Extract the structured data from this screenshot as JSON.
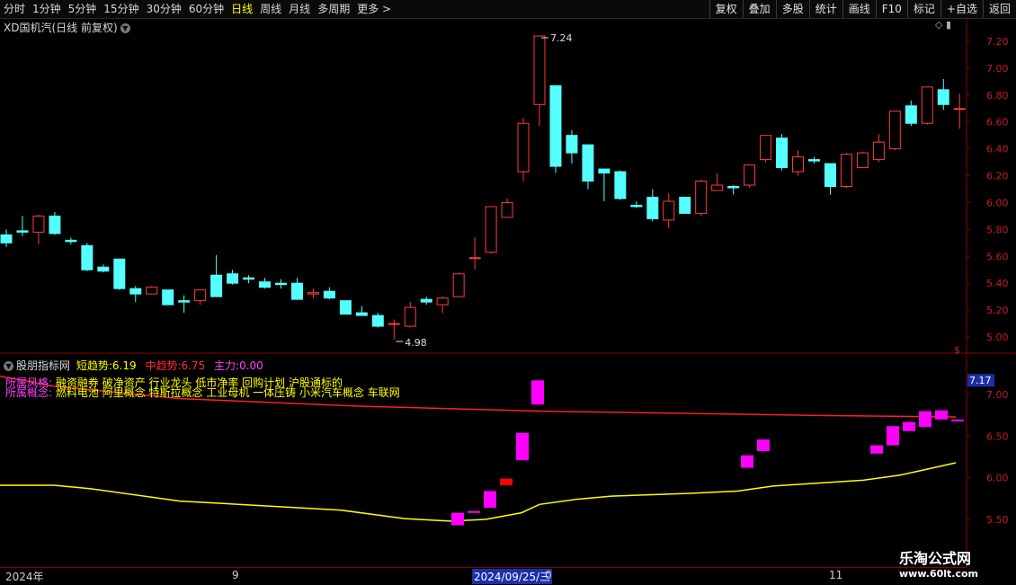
{
  "toolbar": {
    "periods": [
      "分时",
      "1分钟",
      "5分钟",
      "15分钟",
      "30分钟",
      "60分钟",
      "日线",
      "周线",
      "月线",
      "多周期",
      "更多 >"
    ],
    "active_period": "日线",
    "actions": [
      "复权",
      "叠加",
      "多股",
      "统计",
      "画线",
      "F10",
      "标记",
      "+自选",
      "返回"
    ]
  },
  "main_chart": {
    "title": "XD国机汽(日线 前复权)",
    "max_label": "7.24",
    "min_label": "4.98",
    "dollar_icon": "$",
    "y_ticks": [
      "7.20",
      "7.00",
      "6.80",
      "6.60",
      "6.40",
      "6.20",
      "6.00",
      "5.80",
      "5.60",
      "5.40",
      "5.20",
      "5.00"
    ],
    "candles": [
      [
        5.76,
        5.7,
        5.8,
        5.67
      ],
      [
        5.79,
        5.78,
        5.9,
        5.75
      ],
      [
        5.78,
        5.9,
        5.91,
        5.69
      ],
      [
        5.9,
        5.77,
        5.93,
        5.76
      ],
      [
        5.72,
        5.71,
        5.74,
        5.69
      ],
      [
        5.68,
        5.5,
        5.7,
        5.49
      ],
      [
        5.52,
        5.49,
        5.54,
        5.48
      ],
      [
        5.58,
        5.36,
        5.58,
        5.35
      ],
      [
        5.36,
        5.32,
        5.38,
        5.26
      ],
      [
        5.32,
        5.37,
        5.38,
        5.32
      ],
      [
        5.35,
        5.24,
        5.35,
        5.24
      ],
      [
        5.27,
        5.26,
        5.31,
        5.18
      ],
      [
        5.27,
        5.35,
        5.35,
        5.24
      ],
      [
        5.46,
        5.3,
        5.61,
        5.3
      ],
      [
        5.47,
        5.4,
        5.5,
        5.39
      ],
      [
        5.44,
        5.43,
        5.46,
        5.4
      ],
      [
        5.41,
        5.37,
        5.44,
        5.36
      ],
      [
        5.4,
        5.39,
        5.43,
        5.36
      ],
      [
        5.4,
        5.28,
        5.44,
        5.28
      ],
      [
        5.32,
        5.33,
        5.36,
        5.29
      ],
      [
        5.34,
        5.29,
        5.37,
        5.28
      ],
      [
        5.27,
        5.17,
        5.27,
        5.17
      ],
      [
        5.18,
        5.16,
        5.23,
        5.16
      ],
      [
        5.16,
        5.08,
        5.18,
        5.07
      ],
      [
        5.1,
        5.1,
        5.13,
        4.98
      ],
      [
        5.08,
        5.22,
        5.26,
        5.07
      ],
      [
        5.28,
        5.26,
        5.3,
        5.24
      ],
      [
        5.24,
        5.29,
        5.3,
        5.18
      ],
      [
        5.3,
        5.47,
        5.48,
        5.3
      ],
      [
        5.59,
        5.59,
        5.74,
        5.5
      ],
      [
        5.63,
        5.97,
        5.97,
        5.62
      ],
      [
        5.89,
        6.0,
        6.03,
        5.89
      ],
      [
        6.23,
        6.59,
        6.63,
        6.16
      ],
      [
        6.73,
        7.24,
        7.24,
        6.57
      ],
      [
        6.87,
        6.27,
        6.87,
        6.22
      ],
      [
        6.5,
        6.37,
        6.54,
        6.29
      ],
      [
        6.43,
        6.16,
        6.43,
        6.1
      ],
      [
        6.25,
        6.22,
        6.25,
        6.01
      ],
      [
        6.23,
        6.03,
        6.24,
        6.02
      ],
      [
        5.98,
        5.97,
        6.01,
        5.96
      ],
      [
        6.04,
        5.88,
        6.1,
        5.86
      ],
      [
        5.87,
        6.01,
        6.07,
        5.81
      ],
      [
        6.04,
        5.92,
        6.04,
        5.92
      ],
      [
        5.92,
        6.16,
        6.17,
        5.9
      ],
      [
        6.09,
        6.13,
        6.22,
        6.09
      ],
      [
        6.12,
        6.11,
        6.13,
        6.06
      ],
      [
        6.13,
        6.28,
        6.28,
        6.11
      ],
      [
        6.32,
        6.5,
        6.5,
        6.3
      ],
      [
        6.48,
        6.26,
        6.51,
        6.24
      ],
      [
        6.23,
        6.34,
        6.39,
        6.2
      ],
      [
        6.32,
        6.31,
        6.34,
        6.29
      ],
      [
        6.29,
        6.12,
        6.29,
        6.06
      ],
      [
        6.12,
        6.36,
        6.37,
        6.11
      ],
      [
        6.26,
        6.37,
        6.38,
        6.26
      ],
      [
        6.32,
        6.45,
        6.51,
        6.3
      ],
      [
        6.4,
        6.68,
        6.68,
        6.39
      ],
      [
        6.72,
        6.59,
        6.76,
        6.57
      ],
      [
        6.59,
        6.86,
        6.86,
        6.58
      ],
      [
        6.84,
        6.73,
        6.92,
        6.69
      ],
      [
        6.7,
        6.7,
        6.81,
        6.55
      ]
    ]
  },
  "indicator": {
    "name": "股朋指标网",
    "short_label": "短趋势:",
    "short_value": "6.19",
    "mid_label": "中趋势:",
    "mid_value": "6.75",
    "main_label": "主力:",
    "main_value": "0.00",
    "current_value_box": "7.17",
    "y_ticks": [
      "7.00",
      "6.50",
      "6.00",
      "5.50"
    ],
    "risk_label": "所属风格:",
    "risk_text": "融资融券 破净资产 行业龙头 低市净率 回购计划 沪股通标的",
    "concept_label": "所属概念:",
    "concept_text": "燃料电池 阿里概念 特斯拉概念 工业母机 一体压铸 小米汽车概念 车联网",
    "colors": {
      "short_line": "#ffff00",
      "mid_line": "#ff2020",
      "main_bar": "#ff00ff",
      "alt_bar": "#ff0000",
      "tick_bar": "#ff00ff"
    },
    "mid_line": [
      [
        0,
        7.22
      ],
      [
        60,
        7.1
      ],
      [
        200,
        6.95
      ],
      [
        400,
        6.86
      ],
      [
        600,
        6.8
      ],
      [
        900,
        6.75
      ],
      [
        1063,
        6.73
      ]
    ],
    "short_line": [
      [
        0,
        5.91
      ],
      [
        60,
        5.91
      ],
      [
        100,
        5.87
      ],
      [
        200,
        5.72
      ],
      [
        300,
        5.66
      ],
      [
        380,
        5.61
      ],
      [
        450,
        5.51
      ],
      [
        500,
        5.48
      ],
      [
        540,
        5.5
      ],
      [
        580,
        5.58
      ],
      [
        600,
        5.68
      ],
      [
        640,
        5.74
      ],
      [
        680,
        5.78
      ],
      [
        760,
        5.81
      ],
      [
        820,
        5.84
      ],
      [
        860,
        5.9
      ],
      [
        900,
        5.93
      ],
      [
        960,
        5.97
      ],
      [
        1000,
        6.03
      ],
      [
        1030,
        6.1
      ],
      [
        1063,
        6.18
      ]
    ],
    "bars": [
      {
        "x": 509,
        "lo": 5.43,
        "hi": 5.58,
        "c": "main"
      },
      {
        "x": 527,
        "lo": 5.59,
        "hi": 5.6,
        "c": "main"
      },
      {
        "x": 545,
        "lo": 5.64,
        "hi": 5.84,
        "c": "main"
      },
      {
        "x": 563,
        "lo": 5.91,
        "hi": 5.99,
        "c": "alt"
      },
      {
        "x": 581,
        "lo": 6.21,
        "hi": 6.54,
        "c": "main"
      },
      {
        "x": 598,
        "lo": 6.88,
        "hi": 7.17,
        "c": "main"
      },
      {
        "x": 831,
        "lo": 6.12,
        "hi": 6.27,
        "c": "main"
      },
      {
        "x": 849,
        "lo": 6.32,
        "hi": 6.46,
        "c": "main"
      },
      {
        "x": 975,
        "lo": 6.29,
        "hi": 6.39,
        "c": "main"
      },
      {
        "x": 993,
        "lo": 6.39,
        "hi": 6.62,
        "c": "main"
      },
      {
        "x": 1011,
        "lo": 6.56,
        "hi": 6.67,
        "c": "main"
      },
      {
        "x": 1029,
        "lo": 6.61,
        "hi": 6.8,
        "c": "main"
      },
      {
        "x": 1047,
        "lo": 6.7,
        "hi": 6.81,
        "c": "main"
      },
      {
        "x": 1065,
        "lo": 6.69,
        "hi": 6.7,
        "c": "main"
      }
    ]
  },
  "date_axis": {
    "labels": [
      "2024年",
      "9",
      "2024/09/25/三",
      "0",
      "11"
    ]
  },
  "watermark": {
    "line1": "乐淘公式网",
    "line2": "www.60lt.com"
  }
}
